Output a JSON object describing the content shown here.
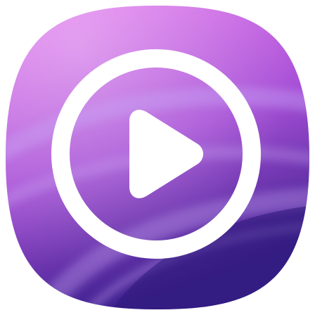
{
  "icon": {
    "name": "video-player-app-icon",
    "glyph": "play-icon",
    "colors": {
      "background": "#ffffff",
      "gradient_top": "#e879f0",
      "gradient_mid": "#a64fd6",
      "gradient_bottom": "#3a1f8c",
      "accent_stripe": "#c9a8f5",
      "glyph": "#ffffff"
    }
  }
}
